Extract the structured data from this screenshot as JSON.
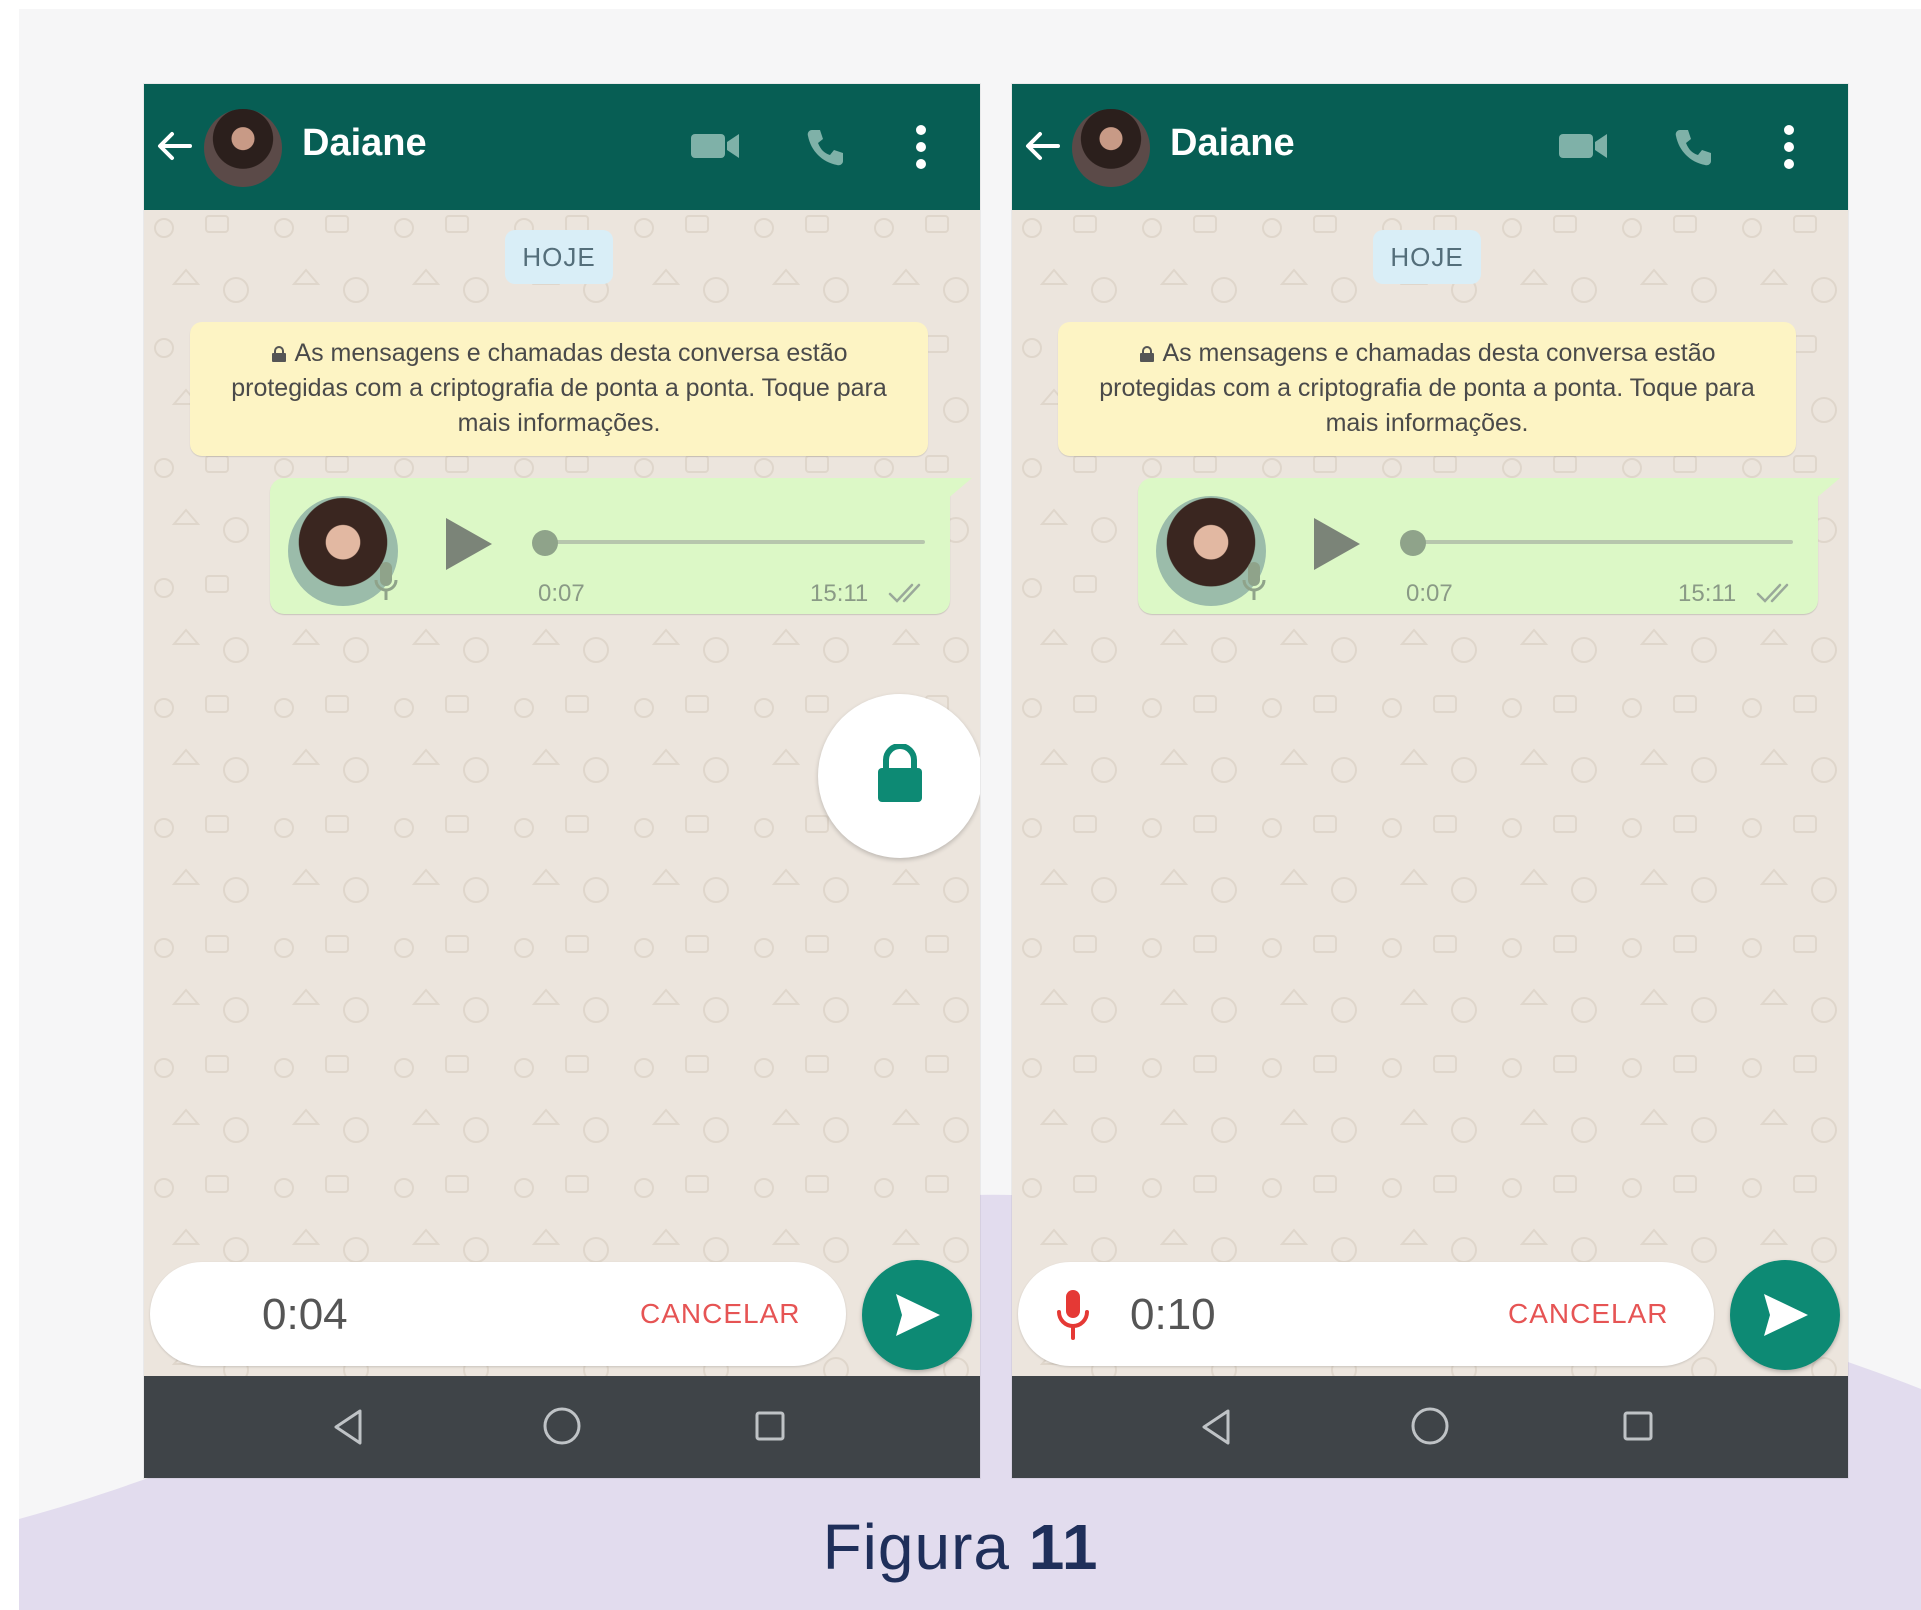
{
  "figure": {
    "caption_word": "Figura",
    "caption_number": "11"
  },
  "colors": {
    "header": "#075e54",
    "chat_background": "#ece5dd",
    "outgoing_bubble": "#dcf8c6",
    "system_note": "#fdf4c4",
    "accent": "#0d8a74",
    "cancel_red": "#e65454",
    "navbar": "#3f4448",
    "wave": "#e2dcee"
  },
  "screens": [
    {
      "header": {
        "back_icon": "arrow-left-icon",
        "contact_name": "Daiane",
        "video_icon": "video-camera-icon",
        "call_icon": "phone-icon",
        "menu_icon": "more-vertical-icon"
      },
      "date_chip": "HOJE",
      "encryption_notice": "As mensagens e chamadas desta conversa estão protegidas com a criptografia de ponta a ponta. Toque para mais informações.",
      "voice_message": {
        "duration": "0:07",
        "time": "15:11",
        "status_icon": "double-check-icon",
        "progress": 0
      },
      "lock_overlay_icon": "lock-icon",
      "recording": {
        "elapsed": "0:04",
        "mic_visible": false,
        "cancel_label": "CANCELAR",
        "send_icon": "send-icon"
      },
      "navbar": {
        "back": "nav-back-icon",
        "home": "nav-home-icon",
        "recents": "nav-recents-icon"
      }
    },
    {
      "header": {
        "back_icon": "arrow-left-icon",
        "contact_name": "Daiane",
        "video_icon": "video-camera-icon",
        "call_icon": "phone-icon",
        "menu_icon": "more-vertical-icon"
      },
      "date_chip": "HOJE",
      "encryption_notice": "As mensagens e chamadas desta conversa estão protegidas com a criptografia de ponta a ponta. Toque para mais informações.",
      "voice_message": {
        "duration": "0:07",
        "time": "15:11",
        "status_icon": "double-check-icon",
        "progress": 0
      },
      "recording": {
        "elapsed": "0:10",
        "mic_visible": true,
        "cancel_label": "CANCELAR",
        "send_icon": "send-icon"
      },
      "navbar": {
        "back": "nav-back-icon",
        "home": "nav-home-icon",
        "recents": "nav-recents-icon"
      }
    }
  ]
}
